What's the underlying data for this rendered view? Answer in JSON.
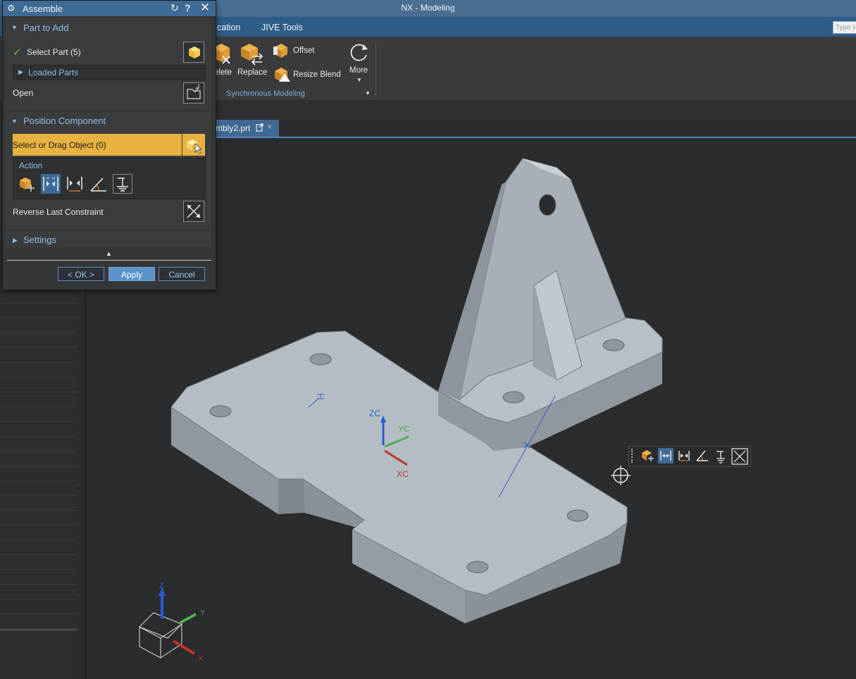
{
  "app": {
    "title": "NX - Modeling"
  },
  "menu": {
    "items": [
      "cation",
      "JIVE Tools"
    ],
    "search_placeholder": "Type H"
  },
  "ribbon": {
    "delete_label": "elete",
    "replace_label": "Replace",
    "offset_label": "Offset",
    "resize_blend_label": "Resize Blend",
    "more_label": "More",
    "group_label": "Synchronous Modeling"
  },
  "document": {
    "tab_label": "mbly2.prt"
  },
  "dialog": {
    "title": "Assemble",
    "part_to_add": {
      "header": "Part to Add",
      "select_part_label": "Select Part (5)",
      "loaded_parts_label": "Loaded Parts",
      "open_label": "Open"
    },
    "position_component": {
      "header": "Position Component",
      "select_label": "Select or Drag Object (0)",
      "action_label": "Action",
      "reverse_label": "Reverse Last Constraint"
    },
    "settings_header": "Settings",
    "buttons": {
      "ok": "< OK >",
      "apply": "Apply",
      "cancel": "Cancel"
    }
  },
  "viewport": {
    "wcs_labels": {
      "z": "ZC",
      "y": "YC",
      "x": "XC"
    },
    "triad_labels": {
      "z": "Z",
      "y": "Y",
      "x": "X"
    }
  },
  "colors": {
    "accent": "#4d87bf",
    "selection": "#e7b23f",
    "part_face": "#a9b3ba",
    "axis_x": "#c0352b",
    "axis_y": "#4caf50",
    "axis_z": "#2a5bd7"
  }
}
